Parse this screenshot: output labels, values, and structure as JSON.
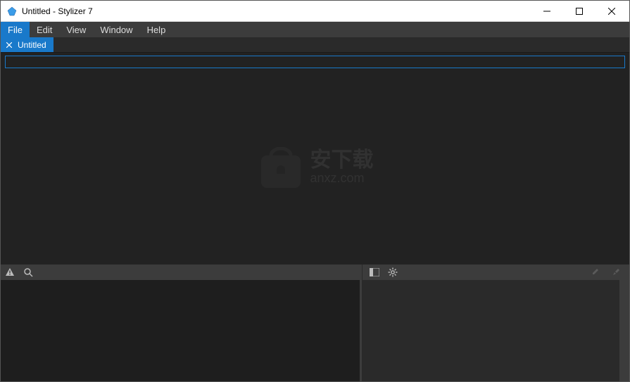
{
  "window": {
    "title": "Untitled - Stylizer 7"
  },
  "menubar": {
    "items": [
      {
        "label": "File",
        "active": true
      },
      {
        "label": "Edit",
        "active": false
      },
      {
        "label": "View",
        "active": false
      },
      {
        "label": "Window",
        "active": false
      },
      {
        "label": "Help",
        "active": false
      }
    ]
  },
  "tab": {
    "label": "Untitled"
  },
  "input": {
    "value": "",
    "placeholder": ""
  },
  "watermark": {
    "text": "安下载",
    "sub": "anxz.com"
  },
  "colors": {
    "accent": "#1979ca",
    "dark_bg": "#222222",
    "panel_bg": "#3c3c3c"
  }
}
